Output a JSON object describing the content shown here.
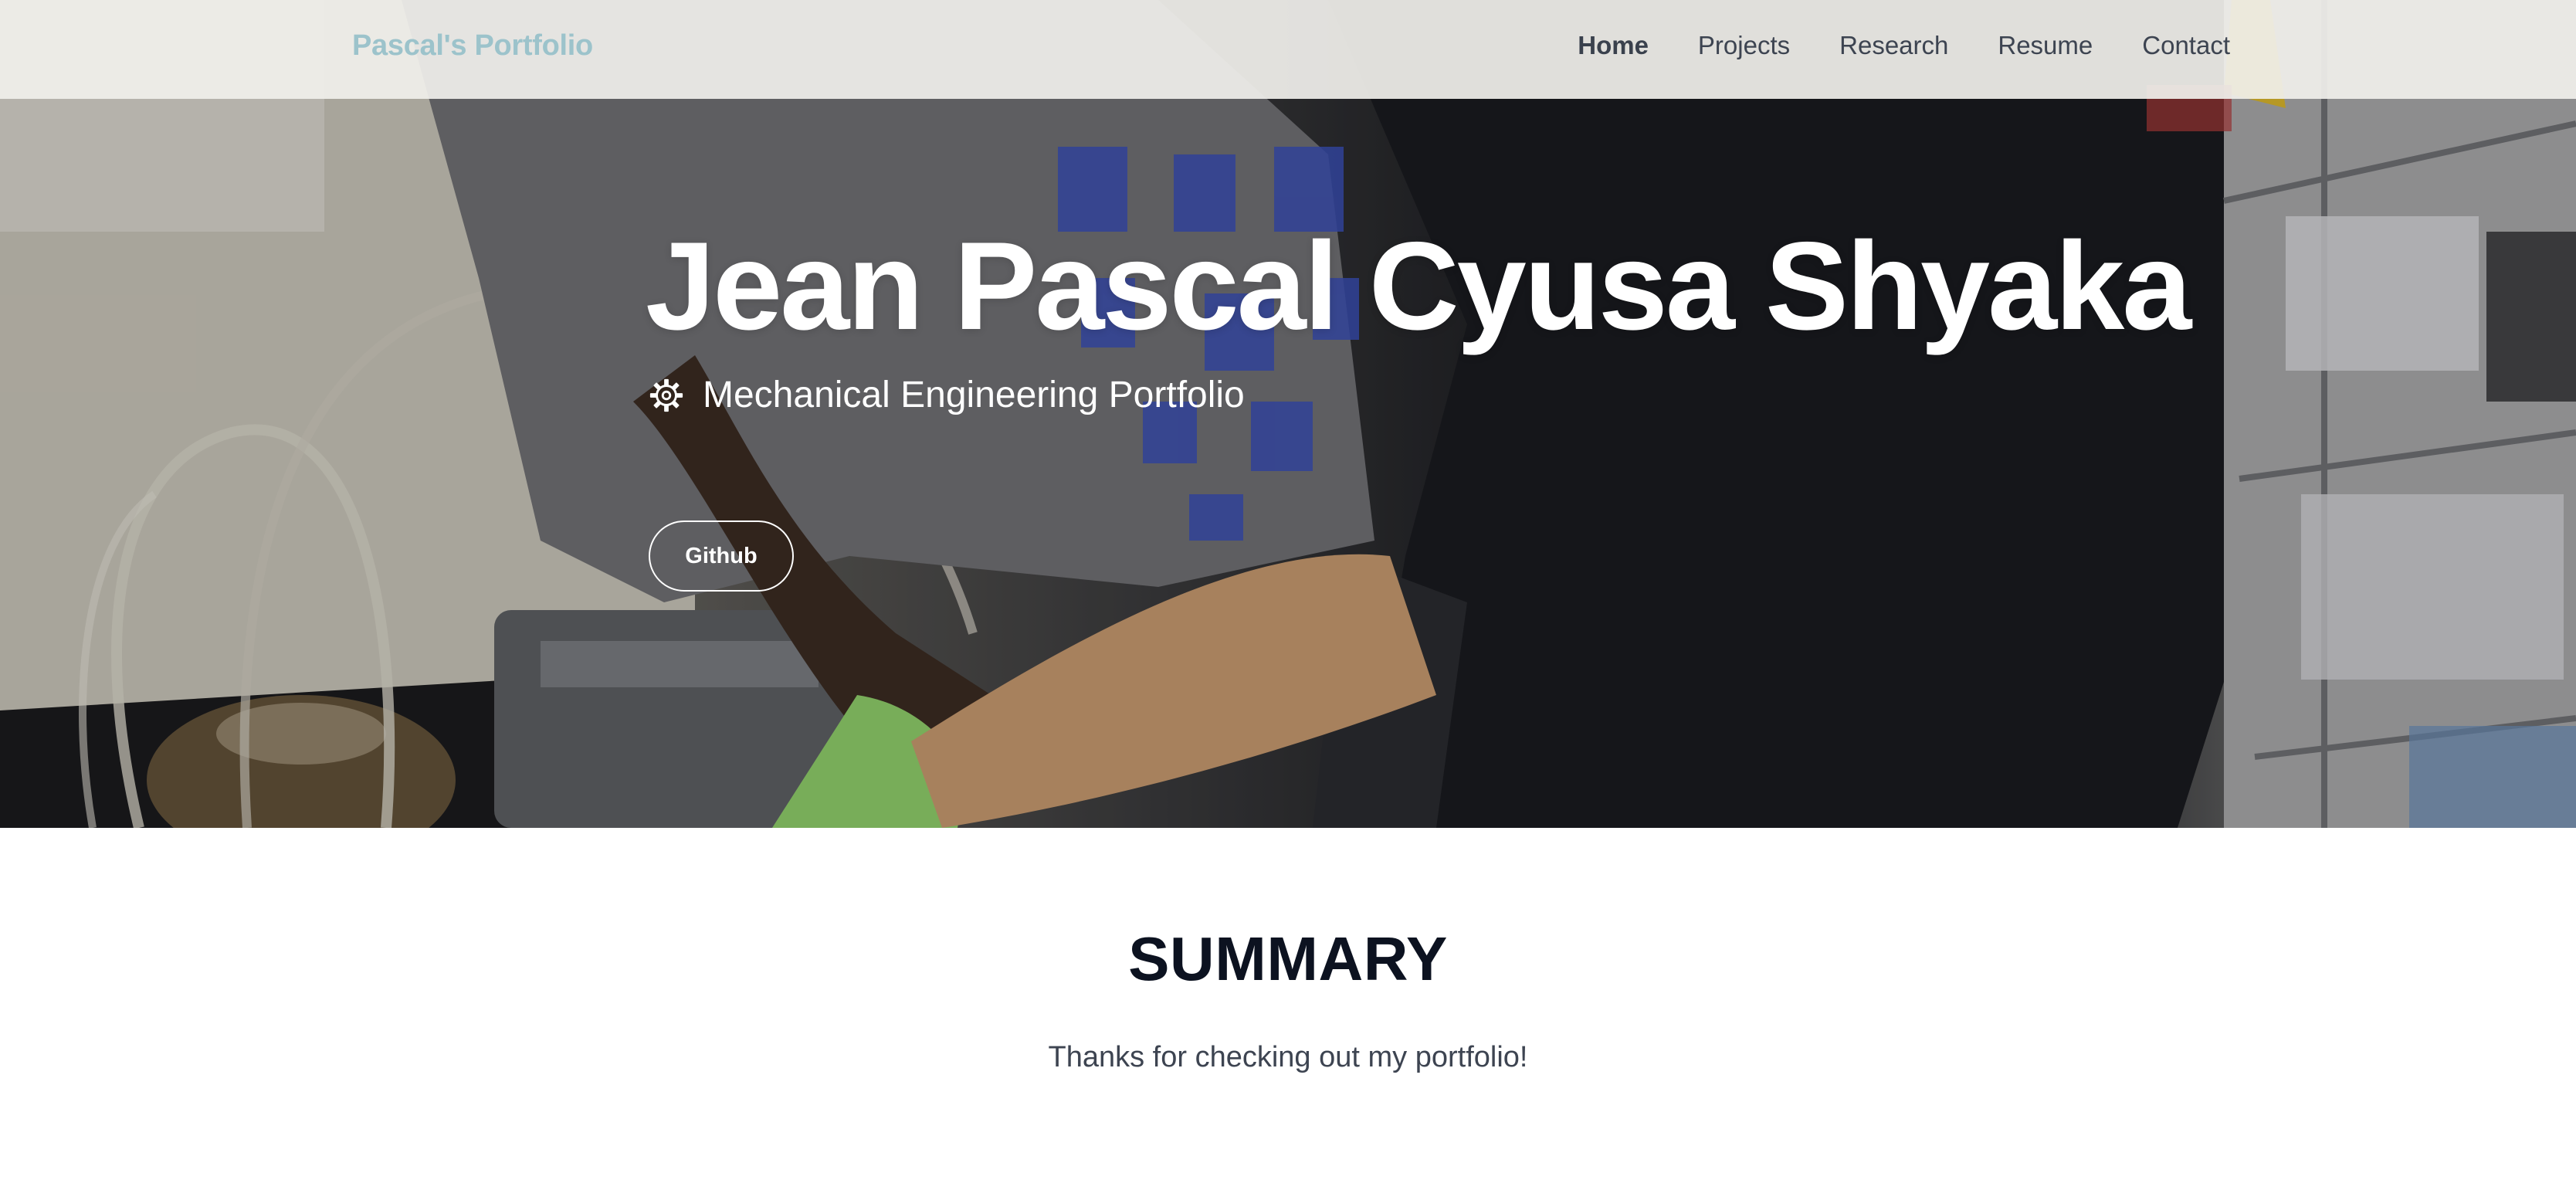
{
  "navbar": {
    "brand": "Pascal's Portfolio",
    "links": [
      {
        "label": "Home",
        "active": true
      },
      {
        "label": "Projects",
        "active": false
      },
      {
        "label": "Research",
        "active": false
      },
      {
        "label": "Resume",
        "active": false
      },
      {
        "label": "Contact",
        "active": false
      }
    ]
  },
  "hero": {
    "title": "Jean Pascal Cyusa Shyaka",
    "subtitle": "Mechanical Engineering Portfolio",
    "subtitle_icon": "gear-icon",
    "button_label": "Github"
  },
  "summary": {
    "heading": "SUMMARY",
    "text": "Thanks for checking out my portfolio!"
  },
  "colors": {
    "brand": "#9cc3cb",
    "nav_text": "#3d4451",
    "heading": "#0c1220",
    "hero_text": "#ffffff"
  }
}
